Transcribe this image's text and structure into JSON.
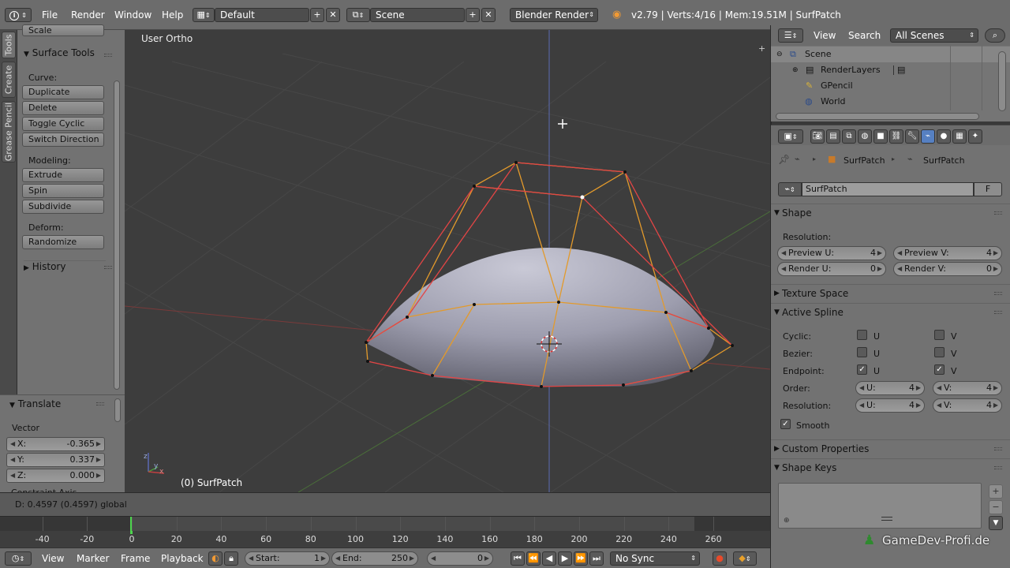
{
  "topbar": {
    "menus": [
      "File",
      "Render",
      "Window",
      "Help"
    ],
    "layout": "Default",
    "scene": "Scene",
    "engine": "Blender Render",
    "stats": "v2.79 | Verts:4/16 | Mem:19.51M | SurfPatch"
  },
  "left_tabs": [
    "Tools",
    "Create",
    "Grease Pencil"
  ],
  "tool_panel": {
    "scale_label": "Scale",
    "surface_tools": "Surface Tools",
    "curve_label": "Curve:",
    "curve_buttons": [
      "Duplicate",
      "Delete",
      "Toggle Cyclic",
      "Switch Direction"
    ],
    "modeling_label": "Modeling:",
    "modeling_buttons": [
      "Extrude",
      "Spin",
      "Subdivide"
    ],
    "deform_label": "Deform:",
    "deform_buttons": [
      "Randomize"
    ],
    "history": "History"
  },
  "translate_panel": {
    "title": "Translate",
    "vector_label": "Vector",
    "x_label": "X:",
    "x": "-0.365",
    "y_label": "Y:",
    "y": "0.337",
    "z_label": "Z:",
    "z": "0.000",
    "cut_label": "Constraint Axis"
  },
  "viewport": {
    "view_name": "User Ortho",
    "object_label": "(0) SurfPatch",
    "axis_labels": [
      "y",
      "x",
      "z"
    ]
  },
  "infobar": {
    "status": "D: 0.4597 (0.4597) global"
  },
  "timeline": {
    "ticks": [
      "-40",
      "-20",
      "0",
      "20",
      "40",
      "60",
      "80",
      "100",
      "120",
      "140",
      "160",
      "180",
      "200",
      "220",
      "240",
      "260"
    ],
    "menus": [
      "View",
      "Marker",
      "Frame",
      "Playback"
    ],
    "start_label": "Start:",
    "start": "1",
    "end_label": "End:",
    "end": "250",
    "current": "0",
    "sync": "No Sync"
  },
  "outliner": {
    "menus": [
      "View",
      "Search"
    ],
    "filter": "All Scenes",
    "items": [
      "Scene",
      "RenderLayers",
      "GPencil",
      "World"
    ]
  },
  "properties": {
    "breadcrumb": [
      "SurfPatch",
      "SurfPatch"
    ],
    "datablock": "SurfPatch",
    "fake_user": "F",
    "shape": {
      "title": "Shape",
      "resolution_label": "Resolution:",
      "preview_u_label": "Preview U:",
      "preview_u": "4",
      "preview_v_label": "Preview V:",
      "preview_v": "4",
      "render_u_label": "Render U:",
      "render_u": "0",
      "render_v_label": "Render V:",
      "render_v": "0"
    },
    "texture_space": "Texture Space",
    "active_spline": {
      "title": "Active Spline",
      "cyclic_label": "Cyclic:",
      "bezier_label": "Bezier:",
      "endpoint_label": "Endpoint:",
      "u": "U",
      "v": "V",
      "order_label": "Order:",
      "order_u_label": "U:",
      "order_u": "4",
      "order_v_label": "V:",
      "order_v": "4",
      "resolution_label": "Resolution:",
      "res_u_label": "U:",
      "res_u": "4",
      "res_v_label": "V:",
      "res_v": "4",
      "smooth": "Smooth"
    },
    "custom_properties": "Custom Properties",
    "shape_keys": "Shape Keys"
  },
  "watermark": "GameDev-Profi.de"
}
